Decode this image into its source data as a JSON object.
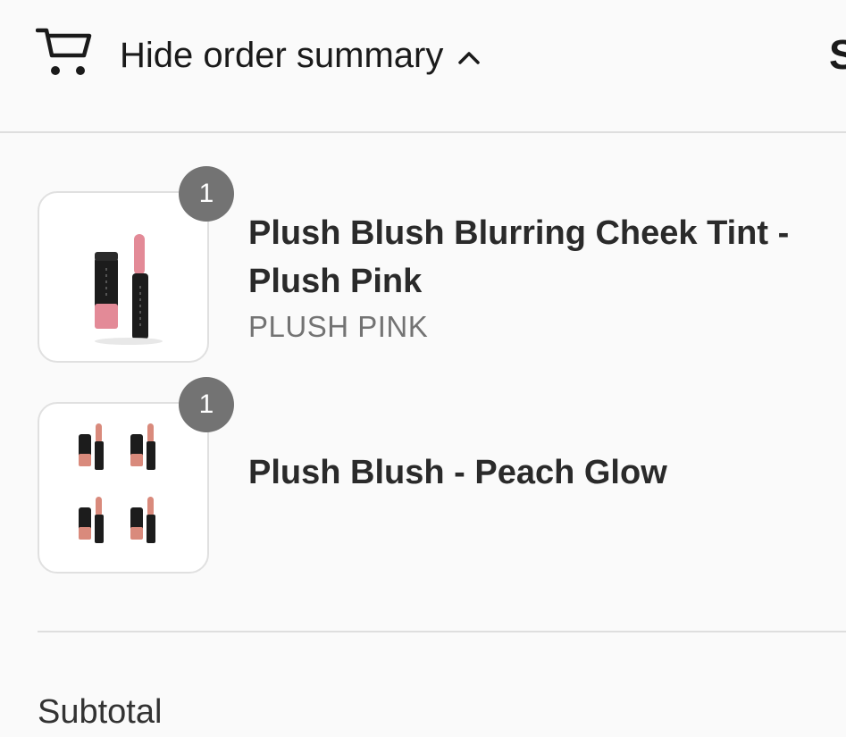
{
  "header": {
    "toggle_label": "Hide order summary",
    "total_peek": "S",
    "icons": {
      "cart": "cart-icon",
      "toggle": "chevron-up-icon"
    }
  },
  "items": [
    {
      "quantity": "1",
      "name": "Plush Blush Blurring Cheek Tint - Plush Pink",
      "variant": "PLUSH PINK",
      "image": "lip-tint-single-icon"
    },
    {
      "quantity": "1",
      "name": "Plush Blush - Peach Glow",
      "variant": "",
      "image": "lip-tint-set-icon"
    }
  ],
  "summary": {
    "subtotal_label": "Subtotal"
  },
  "colors": {
    "badge": "#737373",
    "divider": "#dedede",
    "background": "#fafafa",
    "tint_pink": "#e38a97",
    "tint_peach": "#d98a7c"
  }
}
